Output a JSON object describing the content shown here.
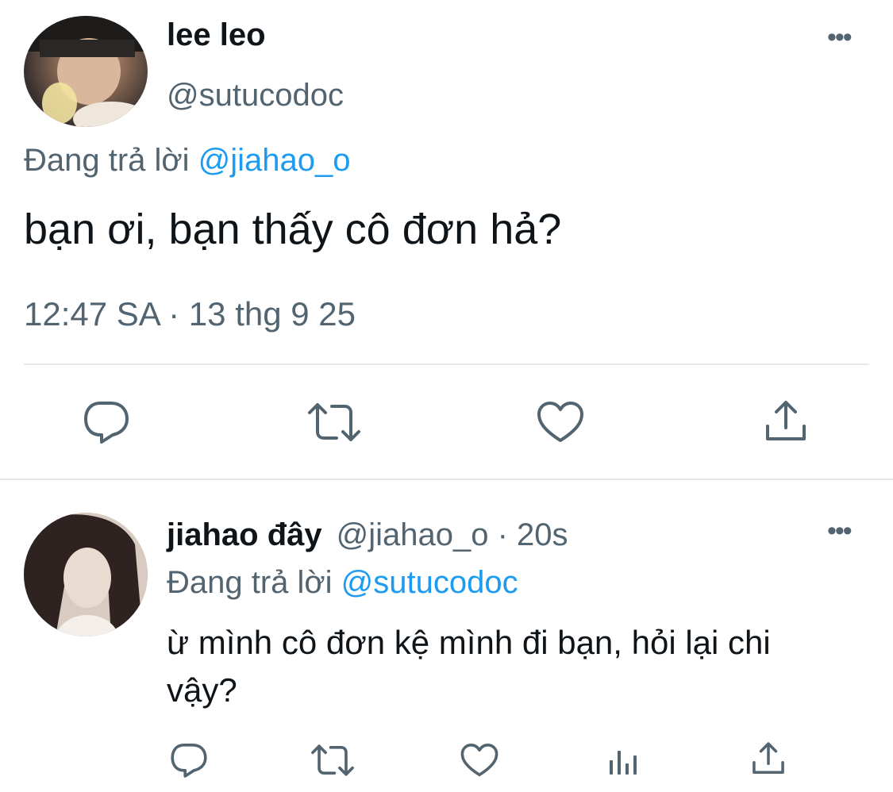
{
  "main_tweet": {
    "display_name": "lee leo",
    "handle": "@sutucodoc",
    "replying_prefix": "Đang trả lời",
    "replying_to": "@jiahao_o",
    "text": "bạn ơi, bạn thấy cô đơn hả?",
    "timestamp": "12:47 SA · 13 thg 9 25",
    "actions": [
      "reply-icon",
      "retweet-icon",
      "like-icon",
      "share-icon"
    ]
  },
  "reply_tweet": {
    "display_name": "jiahao đây",
    "meta": "@jiahao_o · 20s",
    "replying_prefix": "Đang trả lời",
    "replying_to": "@sutucodoc",
    "text": "ừ mình cô đơn kệ mình đi bạn, hỏi lại chi vậy?",
    "actions": [
      "reply-icon",
      "retweet-icon",
      "like-icon",
      "analytics-icon",
      "share-icon"
    ]
  },
  "icons": {
    "more": "•••"
  },
  "colors": {
    "text": "#0f1419",
    "secondary": "#536471",
    "accent": "#1d9bf0",
    "divider": "#e6e9ec"
  }
}
